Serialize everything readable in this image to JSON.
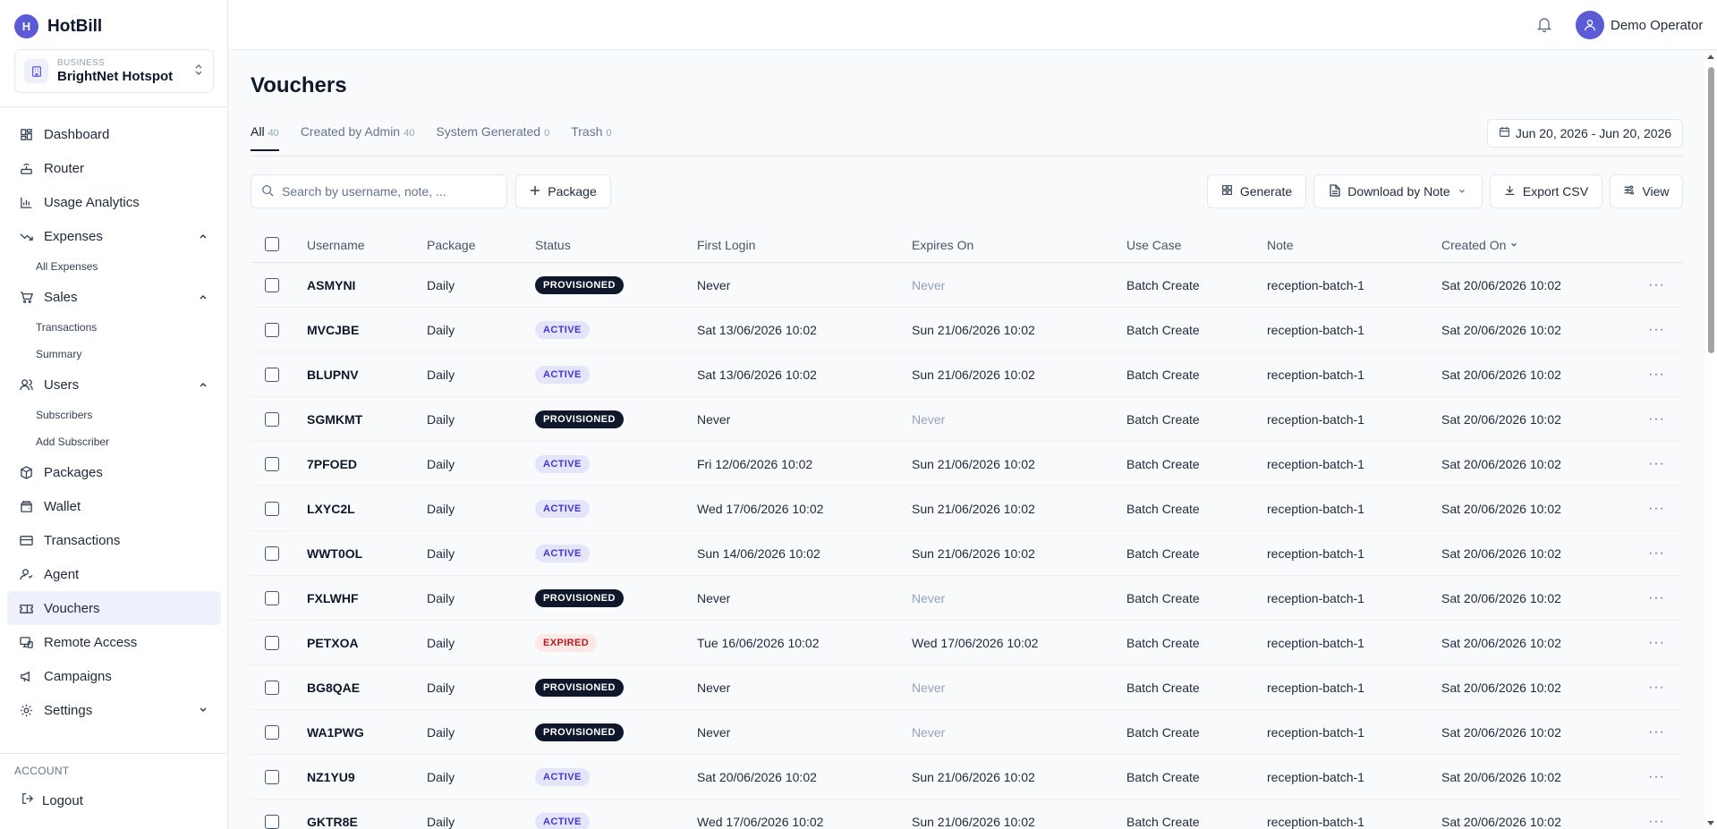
{
  "app": {
    "logo_letter": "H",
    "name": "HotBill"
  },
  "business": {
    "label": "BUSINESS",
    "name": "BrightNet Hotspot"
  },
  "sidebar": {
    "items": [
      {
        "label": "Dashboard",
        "icon": "dashboard-icon"
      },
      {
        "label": "Router",
        "icon": "router-icon"
      },
      {
        "label": "Usage Analytics",
        "icon": "bar-chart-icon"
      },
      {
        "label": "Expenses",
        "icon": "trending-down-icon",
        "expanded": true,
        "children": [
          "All Expenses"
        ]
      },
      {
        "label": "Sales",
        "icon": "cart-icon",
        "expanded": true,
        "children": [
          "Transactions",
          "Summary"
        ]
      },
      {
        "label": "Users",
        "icon": "users-icon",
        "expanded": true,
        "children": [
          "Subscribers",
          "Add Subscriber"
        ]
      },
      {
        "label": "Packages",
        "icon": "package-icon"
      },
      {
        "label": "Wallet",
        "icon": "wallet-icon"
      },
      {
        "label": "Transactions",
        "icon": "credit-card-icon"
      },
      {
        "label": "Agent",
        "icon": "agent-icon"
      },
      {
        "label": "Vouchers",
        "icon": "ticket-icon",
        "active": true
      },
      {
        "label": "Remote Access",
        "icon": "monitor-icon"
      },
      {
        "label": "Campaigns",
        "icon": "megaphone-icon"
      },
      {
        "label": "Settings",
        "icon": "gear-icon",
        "expanded": false
      }
    ],
    "account_label": "ACCOUNT",
    "logout_label": "Logout"
  },
  "topbar": {
    "user_name": "Demo Operator"
  },
  "page": {
    "title": "Vouchers",
    "tabs": [
      {
        "label": "All",
        "count": "40",
        "active": true
      },
      {
        "label": "Created by Admin",
        "count": "40"
      },
      {
        "label": "System Generated",
        "count": "0"
      },
      {
        "label": "Trash",
        "count": "0"
      }
    ],
    "date_range": "Jun 20, 2026 - Jun 20, 2026"
  },
  "toolbar": {
    "search_placeholder": "Search by username, note, ...",
    "package_label": "Package",
    "generate_label": "Generate",
    "download_label": "Download by Note",
    "export_label": "Export CSV",
    "view_label": "View"
  },
  "table": {
    "columns": [
      "Username",
      "Package",
      "Status",
      "First Login",
      "Expires On",
      "Use Case",
      "Note",
      "Created On"
    ],
    "rows": [
      {
        "username": "ASMYNI",
        "package": "Daily",
        "status": "PROVISIONED",
        "first_login": "Never",
        "expires_on": "Never",
        "use_case": "Batch Create",
        "note": "reception-batch-1",
        "created_on": "Sat 20/06/2026 10:02"
      },
      {
        "username": "MVCJBE",
        "package": "Daily",
        "status": "ACTIVE",
        "first_login": "Sat 13/06/2026 10:02",
        "expires_on": "Sun 21/06/2026 10:02",
        "use_case": "Batch Create",
        "note": "reception-batch-1",
        "created_on": "Sat 20/06/2026 10:02"
      },
      {
        "username": "BLUPNV",
        "package": "Daily",
        "status": "ACTIVE",
        "first_login": "Sat 13/06/2026 10:02",
        "expires_on": "Sun 21/06/2026 10:02",
        "use_case": "Batch Create",
        "note": "reception-batch-1",
        "created_on": "Sat 20/06/2026 10:02"
      },
      {
        "username": "SGMKMT",
        "package": "Daily",
        "status": "PROVISIONED",
        "first_login": "Never",
        "expires_on": "Never",
        "use_case": "Batch Create",
        "note": "reception-batch-1",
        "created_on": "Sat 20/06/2026 10:02"
      },
      {
        "username": "7PFOED",
        "package": "Daily",
        "status": "ACTIVE",
        "first_login": "Fri 12/06/2026 10:02",
        "expires_on": "Sun 21/06/2026 10:02",
        "use_case": "Batch Create",
        "note": "reception-batch-1",
        "created_on": "Sat 20/06/2026 10:02"
      },
      {
        "username": "LXYC2L",
        "package": "Daily",
        "status": "ACTIVE",
        "first_login": "Wed 17/06/2026 10:02",
        "expires_on": "Sun 21/06/2026 10:02",
        "use_case": "Batch Create",
        "note": "reception-batch-1",
        "created_on": "Sat 20/06/2026 10:02"
      },
      {
        "username": "WWT0OL",
        "package": "Daily",
        "status": "ACTIVE",
        "first_login": "Sun 14/06/2026 10:02",
        "expires_on": "Sun 21/06/2026 10:02",
        "use_case": "Batch Create",
        "note": "reception-batch-1",
        "created_on": "Sat 20/06/2026 10:02"
      },
      {
        "username": "FXLWHF",
        "package": "Daily",
        "status": "PROVISIONED",
        "first_login": "Never",
        "expires_on": "Never",
        "use_case": "Batch Create",
        "note": "reception-batch-1",
        "created_on": "Sat 20/06/2026 10:02"
      },
      {
        "username": "PETXOA",
        "package": "Daily",
        "status": "EXPIRED",
        "first_login": "Tue 16/06/2026 10:02",
        "expires_on": "Wed 17/06/2026 10:02",
        "use_case": "Batch Create",
        "note": "reception-batch-1",
        "created_on": "Sat 20/06/2026 10:02"
      },
      {
        "username": "BG8QAE",
        "package": "Daily",
        "status": "PROVISIONED",
        "first_login": "Never",
        "expires_on": "Never",
        "use_case": "Batch Create",
        "note": "reception-batch-1",
        "created_on": "Sat 20/06/2026 10:02"
      },
      {
        "username": "WA1PWG",
        "package": "Daily",
        "status": "PROVISIONED",
        "first_login": "Never",
        "expires_on": "Never",
        "use_case": "Batch Create",
        "note": "reception-batch-1",
        "created_on": "Sat 20/06/2026 10:02"
      },
      {
        "username": "NZ1YU9",
        "package": "Daily",
        "status": "ACTIVE",
        "first_login": "Sat 20/06/2026 10:02",
        "expires_on": "Sun 21/06/2026 10:02",
        "use_case": "Batch Create",
        "note": "reception-batch-1",
        "created_on": "Sat 20/06/2026 10:02"
      },
      {
        "username": "GKTR8E",
        "package": "Daily",
        "status": "ACTIVE",
        "first_login": "Wed 17/06/2026 10:02",
        "expires_on": "Sun 21/06/2026 10:02",
        "use_case": "Batch Create",
        "note": "reception-batch-1",
        "created_on": "Sat 20/06/2026 10:02"
      }
    ],
    "more_glyph": "···"
  },
  "colors": {
    "accent": "#5b5bd6",
    "provisioned": "#0f172a",
    "active_bg": "#e4e4fb",
    "active_fg": "#4338ca",
    "expired_bg": "#fde8e8",
    "expired_fg": "#b91c1c"
  }
}
